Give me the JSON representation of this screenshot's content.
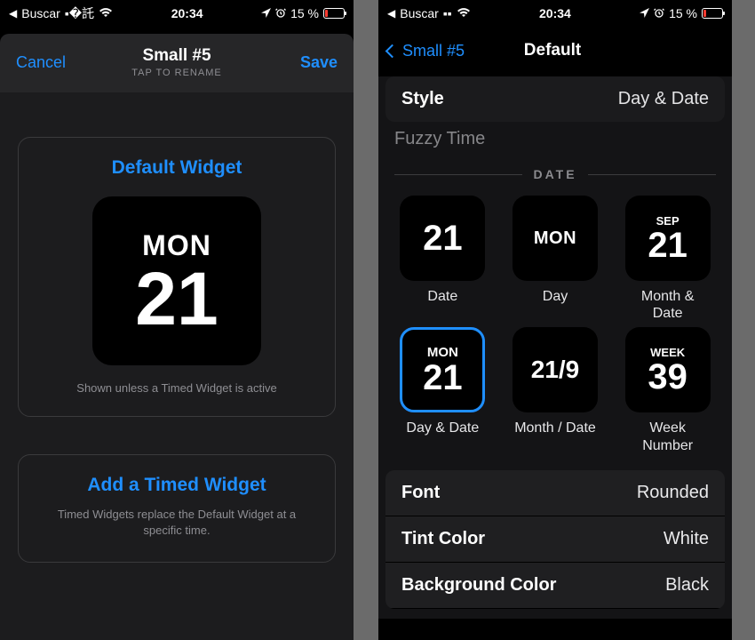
{
  "status": {
    "back_app": "Buscar",
    "time": "20:34",
    "battery_pct": "15 %"
  },
  "left": {
    "cancel": "Cancel",
    "save": "Save",
    "title": "Small #5",
    "subtitle": "TAP TO RENAME",
    "default_widget": {
      "title": "Default Widget",
      "day": "MON",
      "date": "21",
      "caption": "Shown unless a Timed Widget is active"
    },
    "timed": {
      "title": "Add a Timed Widget",
      "caption": "Timed Widgets replace the Default Widget at a specific time."
    }
  },
  "right": {
    "back": "Small #5",
    "title": "Default",
    "style": {
      "label": "Style",
      "value": "Day & Date"
    },
    "fuzzy": "Fuzzy Time",
    "section": "DATE",
    "tiles": [
      {
        "kind": "date",
        "lines": [
          "21"
        ],
        "label": "Date",
        "selected": false
      },
      {
        "kind": "day",
        "lines": [
          "MON"
        ],
        "label": "Day",
        "selected": false
      },
      {
        "kind": "month_date",
        "lines": [
          "SEP",
          "21"
        ],
        "label": "Month &\nDate",
        "selected": false
      },
      {
        "kind": "day_date",
        "lines": [
          "MON",
          "21"
        ],
        "label": "Day & Date",
        "selected": true
      },
      {
        "kind": "month_slash",
        "lines": [
          "21/9"
        ],
        "label": "Month / Date",
        "selected": false
      },
      {
        "kind": "week",
        "lines": [
          "WEEK",
          "39"
        ],
        "label": "Week\nNumber",
        "selected": false
      }
    ],
    "settings": [
      {
        "label": "Font",
        "value": "Rounded"
      },
      {
        "label": "Tint Color",
        "value": "White"
      },
      {
        "label": "Background Color",
        "value": "Black"
      }
    ]
  }
}
